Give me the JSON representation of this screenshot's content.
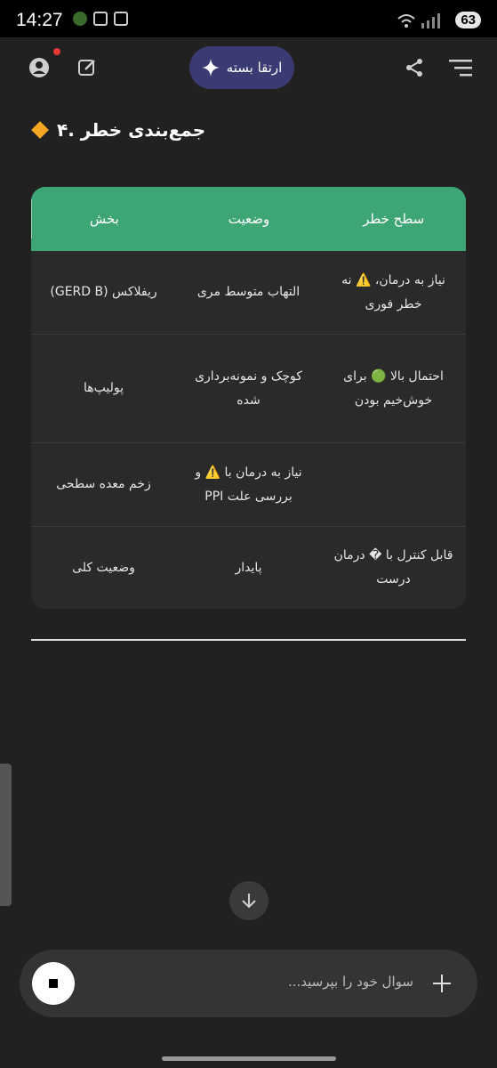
{
  "status_bar": {
    "time": "14:27",
    "battery": "63"
  },
  "top_bar": {
    "upgrade_label": "ارتقا بسته"
  },
  "section": {
    "title": "جمع‌بندی خطر .۴"
  },
  "table": {
    "headers": [
      "سطح خطر",
      "وضعیت",
      "بخش"
    ],
    "rows": [
      {
        "risk": "نیاز به درمان، ⚠️ نه خطر فوری",
        "status": "التهاب متوسط مری",
        "part": "ریفلاکس (GERD B)"
      },
      {
        "risk": "احتمال بالا 🟢 برای خوش‌خیم بودن",
        "status": "کوچک و نمونه‌برداری شده",
        "part": "پولیپ‌ها"
      },
      {
        "risk": "",
        "status": "نیاز به درمان با ⚠️ و بررسی علت PPI",
        "part": "زخم معده سطحی"
      },
      {
        "risk": "قابل کنترل با � درمان درست",
        "status": "پایدار",
        "part": "وضعیت کلی"
      }
    ]
  },
  "composer": {
    "placeholder": "سوال خود را بپرسید..."
  },
  "colors": {
    "header_green": "#3ea575",
    "upgrade_bg": "#3b3b73",
    "background": "#212121"
  }
}
